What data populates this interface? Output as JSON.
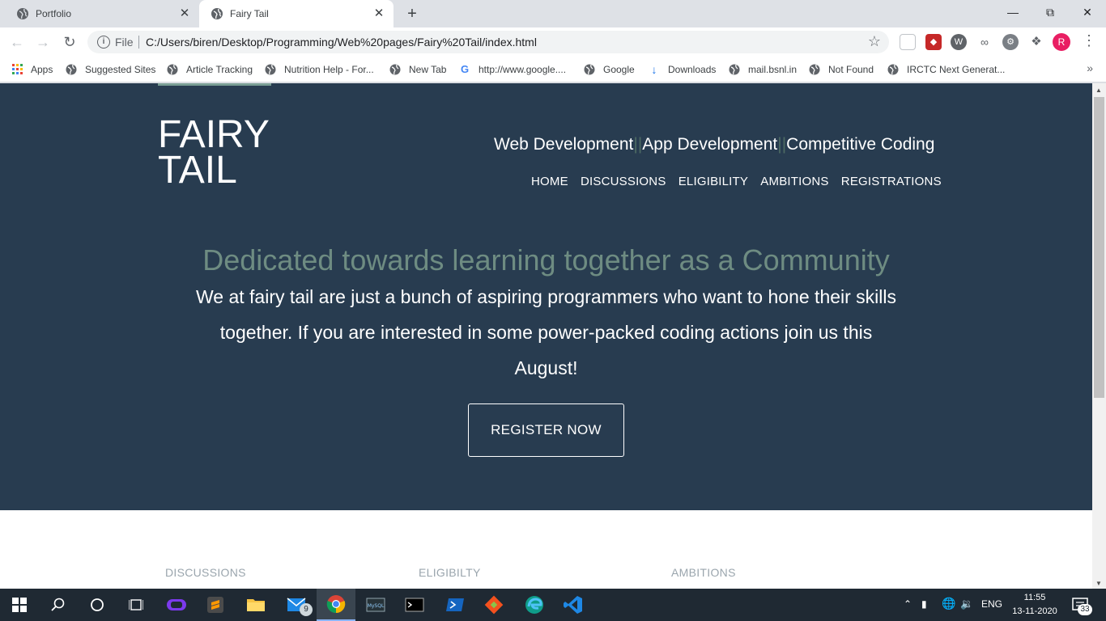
{
  "browser": {
    "tabs": [
      {
        "title": "Portfolio",
        "active": false
      },
      {
        "title": "Fairy Tail",
        "active": true
      }
    ],
    "address": {
      "scheme_label": "File",
      "url": "C:/Users/biren/Desktop/Programming/Web%20pages/Fairy%20Tail/index.html"
    },
    "profile_initial": "R",
    "bookmarks": [
      "Apps",
      "Suggested Sites",
      "Article Tracking",
      "Nutrition Help - For...",
      "New Tab",
      "http://www.google....",
      "Google",
      "Downloads",
      "mail.bsnl.in",
      "Not Found",
      "IRCTC Next Generat..."
    ]
  },
  "site": {
    "logo_line1": "FAIRY",
    "logo_line2": "TAIL",
    "tagline": {
      "part1": "Web Development",
      "separator": "||",
      "part2": "App Development",
      "part3": "Competitive Coding"
    },
    "nav": [
      "HOME",
      "DISCUSSIONS",
      "ELIGIBILITY",
      "AMBITIONS",
      "REGISTRATIONS"
    ],
    "hero_title": "Dedicated towards learning together as a Community",
    "hero_text": "We at fairy tail are just a bunch of aspiring programmers who want to hone their skills together. If you are interested in some power-packed coding actions join us this August!",
    "cta_label": "REGISTER NOW",
    "sections": [
      "DISCUSSIONS",
      "ELIGIBILTY",
      "AMBITIONS"
    ]
  },
  "colors": {
    "hero_bg": "#283c50",
    "accent": "#6e8c82"
  },
  "taskbar": {
    "mail_badge": "9",
    "language": "ENG",
    "time": "11:55",
    "date": "13-11-2020",
    "notification_count": "33"
  }
}
